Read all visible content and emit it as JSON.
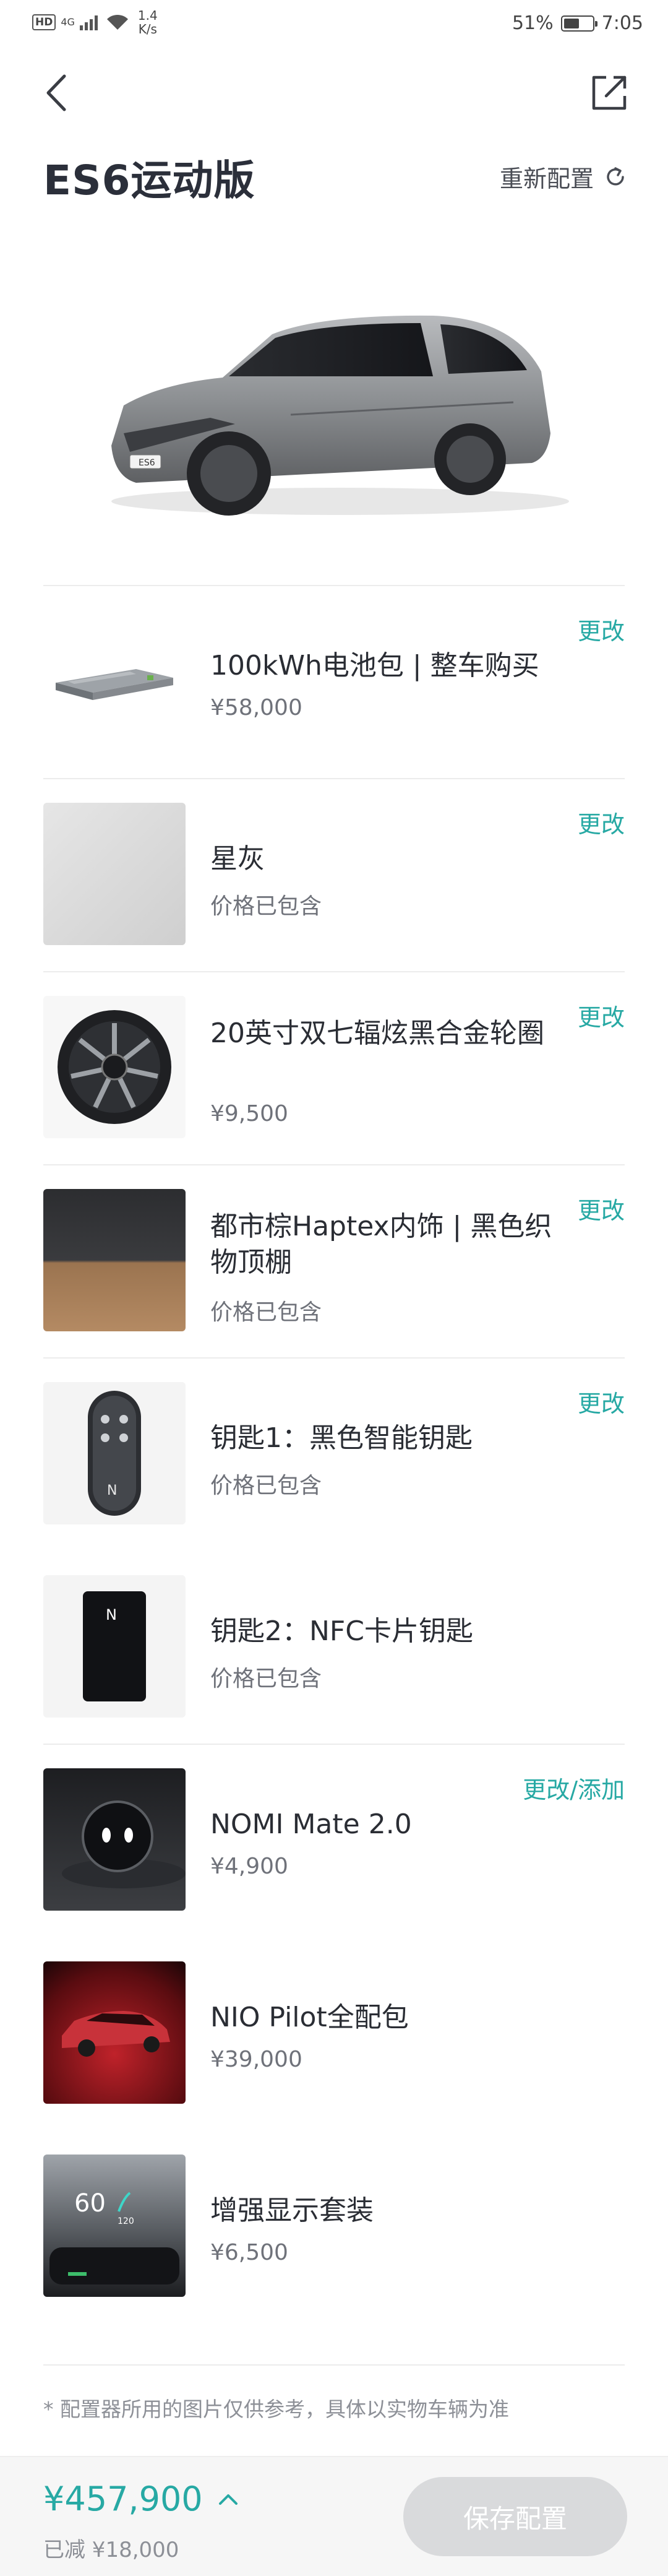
{
  "status_bar": {
    "hd": "HD",
    "network": "4G",
    "speed_value": "1.4",
    "speed_unit": "K/s",
    "battery": "51%",
    "time": "7:05"
  },
  "header": {
    "back_icon": "chevron-left-icon",
    "share_icon": "share-external-icon"
  },
  "title": "ES6运动版",
  "reconfigure_label": "重新配置",
  "items": [
    {
      "name": "100kWh电池包 | 整车购买",
      "price": "¥58,000",
      "change": "更改",
      "thumb": "battery-pack"
    },
    {
      "name": "星灰",
      "price": "价格已包含",
      "change": "更改",
      "thumb": "paint-swatch"
    },
    {
      "name": "20英寸双七辐炫黑合金轮圈",
      "price": "¥9,500",
      "change": "更改",
      "thumb": "wheel"
    },
    {
      "name": "都市棕Haptex内饰 | 黑色织物顶棚",
      "price": "价格已包含",
      "change": "更改",
      "thumb": "interior-swatch"
    },
    {
      "name": "钥匙1：黑色智能钥匙",
      "price": "价格已包含",
      "change": "更改",
      "thumb": "smart-key"
    },
    {
      "name": "钥匙2：NFC卡片钥匙",
      "price": "价格已包含",
      "change": "",
      "thumb": "nfc-card"
    },
    {
      "name": "NOMI Mate 2.0",
      "price": "¥4,900",
      "change": "更改/添加",
      "thumb": "nomi"
    },
    {
      "name": "NIO Pilot全配包",
      "price": "¥39,000",
      "change": "",
      "thumb": "pilot"
    },
    {
      "name": "增强显示套装",
      "price": "¥6,500",
      "change": "",
      "thumb": "hud"
    }
  ],
  "hud_thumb": {
    "speed": "60",
    "small": "120"
  },
  "disclaimer": "* 配置器所用的图片仅供参考，具体以实物车辆为准",
  "bottom": {
    "total": "¥457,900",
    "saving": "已减 ¥18,000",
    "save_button": "保存配置"
  },
  "colors": {
    "accent": "#27a9a4",
    "button_disabled": "#d9dadc"
  }
}
